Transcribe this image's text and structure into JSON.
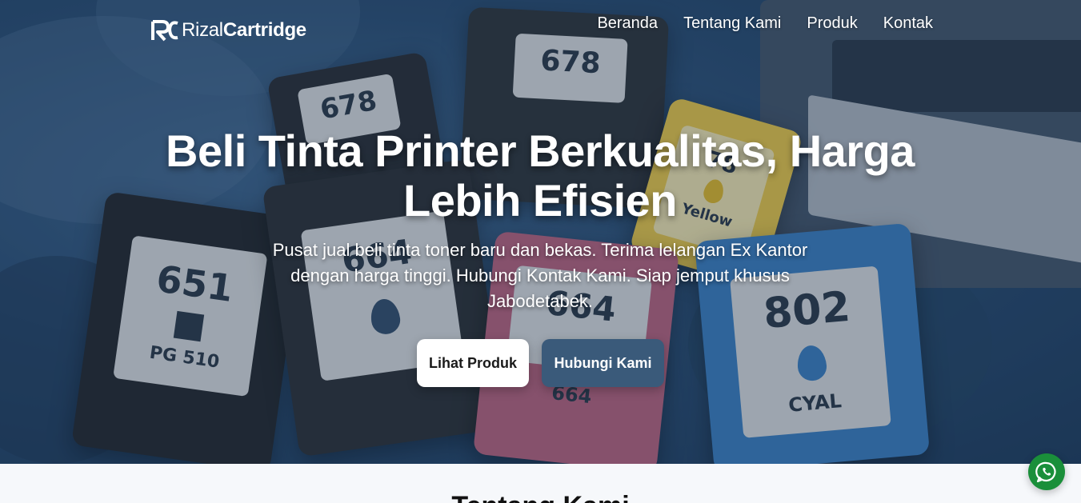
{
  "brand": {
    "prefix": "Rizal",
    "suffix": "Cartridge"
  },
  "nav": {
    "items": [
      "Beranda",
      "Tentang Kami",
      "Produk",
      "Kontak"
    ]
  },
  "hero": {
    "title": "Beli Tinta Printer Berkualitas, Harga Lebih Efisien",
    "subtitle": "Pusat jual beli tinta toner baru dan bekas. Terima lelangan Ex Kantor dengan harga tinggi. Hubungi Kontak Kami. Siap jemput khusus Jabodetabek.",
    "primary_button": "Lihat Produk",
    "secondary_button": "Hubungi Kami"
  },
  "hero_image": {
    "cartridges": [
      {
        "number": "651",
        "sub": "PG 510"
      },
      {
        "number": "664",
        "sub": ""
      },
      {
        "number": "664",
        "sub": "664"
      },
      {
        "number": "802",
        "sub": "CYAL"
      },
      {
        "number": "678",
        "sub": ""
      },
      {
        "number": "678",
        "sub": ""
      },
      {
        "number": "78",
        "sub": "Yellow"
      }
    ]
  },
  "about": {
    "title": "Tentang Kami"
  },
  "colors": {
    "hero_overlay": "#2b4f75",
    "secondary_button": "#3a5a7a",
    "whatsapp": "#1a8f3a"
  }
}
